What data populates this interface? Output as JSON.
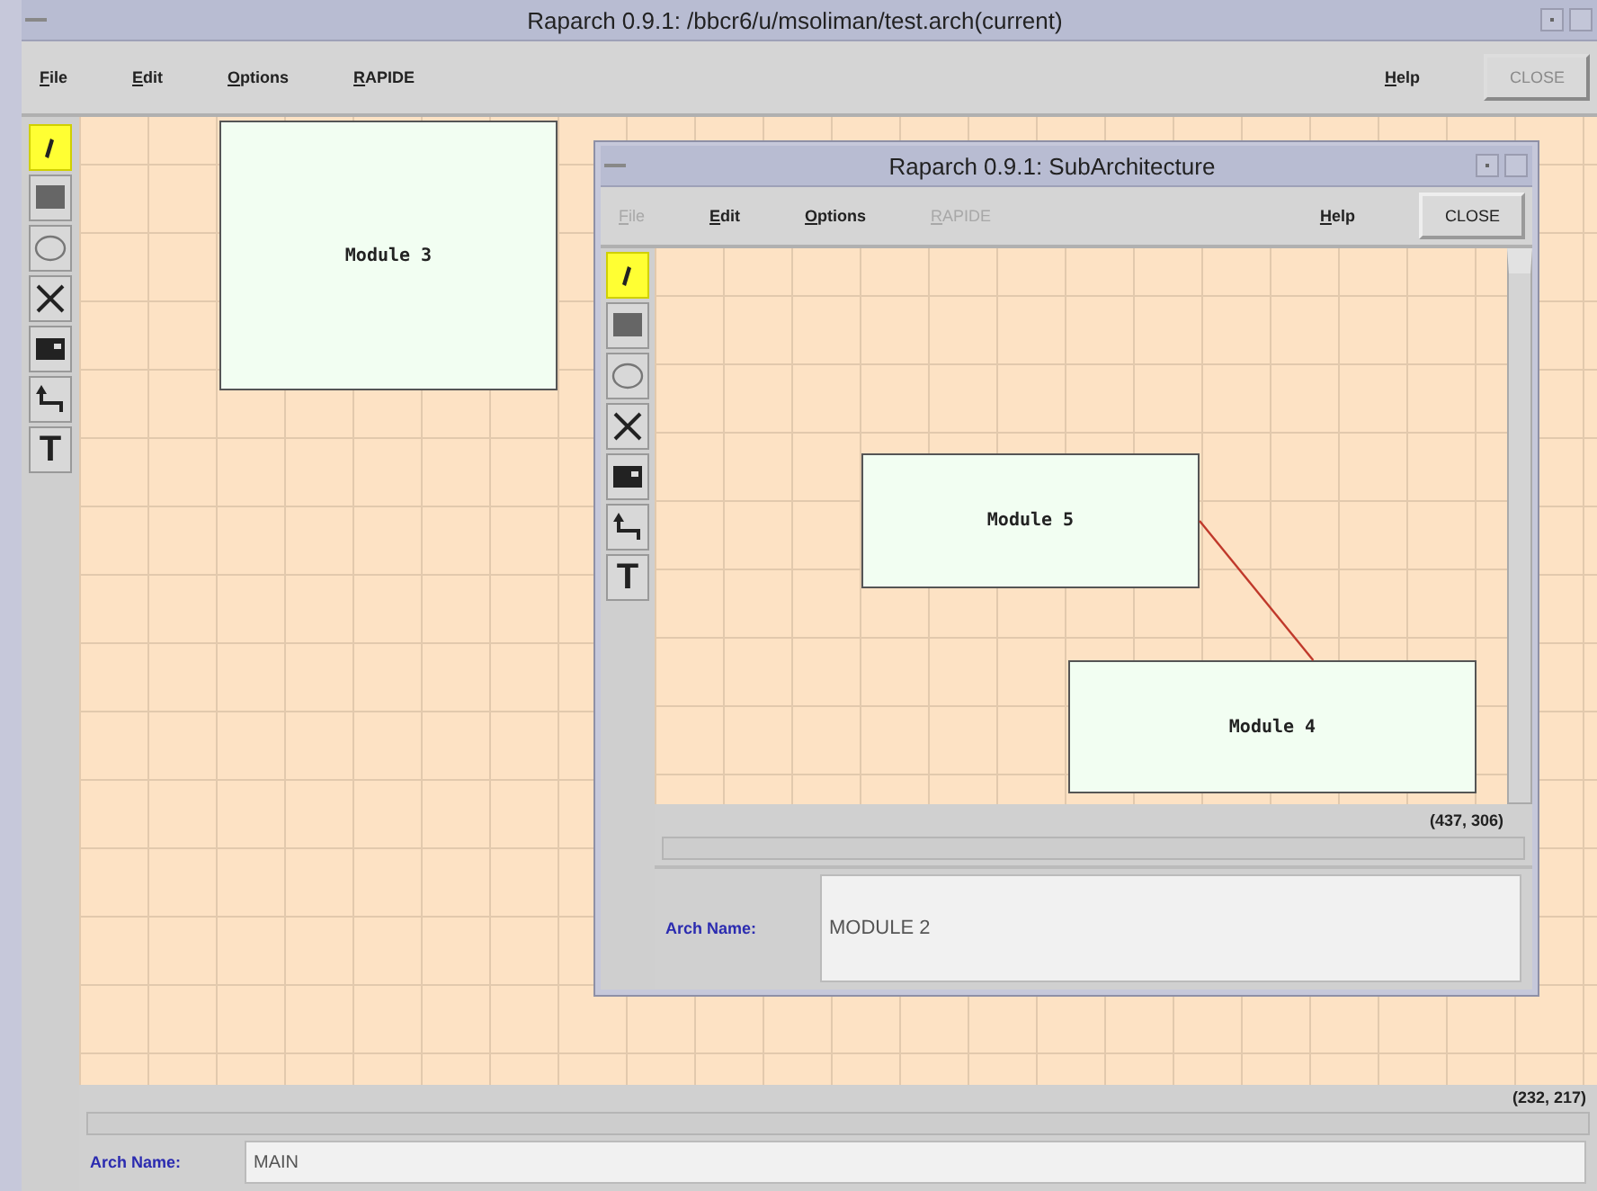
{
  "main_window": {
    "title": "Raparch 0.9.1:  /bbcr6/u/msoliman/test.arch(current)",
    "menu": [
      {
        "label": "File",
        "disabled": false
      },
      {
        "label": "Edit",
        "disabled": false
      },
      {
        "label": "Options",
        "disabled": false
      },
      {
        "label": "RAPIDE",
        "disabled": false
      }
    ],
    "help": "Help",
    "close_button": {
      "label": "CLOSE",
      "disabled": true
    },
    "tools": [
      {
        "kind": "select",
        "selected": true
      },
      {
        "kind": "rectangle",
        "selected": false
      },
      {
        "kind": "ellipse",
        "selected": false
      },
      {
        "kind": "cross",
        "selected": false
      },
      {
        "kind": "camera",
        "selected": false
      },
      {
        "kind": "elbow",
        "selected": false
      },
      {
        "kind": "text",
        "glyph": "T",
        "selected": false
      }
    ],
    "modules": [
      {
        "label": "Module 3"
      }
    ],
    "coordinates": "(232, 217)",
    "arch_name": {
      "label": "Arch Name:",
      "value": "MAIN"
    }
  },
  "sub_window": {
    "title": "Raparch 0.9.1: SubArchitecture",
    "menu": [
      {
        "label": "File",
        "disabled": true
      },
      {
        "label": "Edit",
        "disabled": false
      },
      {
        "label": "Options",
        "disabled": false
      },
      {
        "label": "RAPIDE",
        "disabled": true
      }
    ],
    "help": "Help",
    "close_button": {
      "label": "CLOSE",
      "disabled": false
    },
    "tools": [
      {
        "kind": "select",
        "selected": true
      },
      {
        "kind": "rectangle",
        "selected": false
      },
      {
        "kind": "ellipse",
        "selected": false
      },
      {
        "kind": "cross",
        "selected": false
      },
      {
        "kind": "camera",
        "selected": false
      },
      {
        "kind": "elbow",
        "selected": false
      },
      {
        "kind": "text",
        "glyph": "T",
        "selected": false
      }
    ],
    "modules": [
      {
        "label": "Module 5"
      },
      {
        "label": "Module 4"
      }
    ],
    "connections": [
      {
        "kind": "line"
      }
    ],
    "coordinates": "(437, 306)",
    "arch_name": {
      "label": "Arch Name:",
      "value": "MODULE 2"
    }
  }
}
